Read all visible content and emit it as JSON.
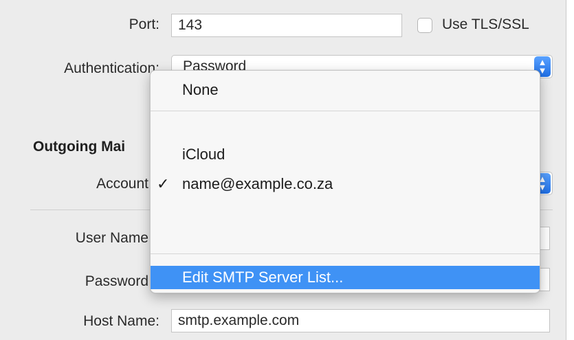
{
  "incoming": {
    "port_label": "Port:",
    "port_value": "143",
    "tls_label": "Use TLS/SSL",
    "auth_label": "Authentication:",
    "auth_value": "Password"
  },
  "outgoing": {
    "section_title": "Outgoing Mai",
    "account_label": "Account",
    "user_name_label": "User Name",
    "password_label": "Password",
    "host_name_label": "Host Name:",
    "host_name_value": "smtp.example.com"
  },
  "menu": {
    "items": [
      {
        "label": "None",
        "checked": false
      },
      {
        "label": "iCloud",
        "checked": false
      },
      {
        "label": "name@example.co.za",
        "checked": true
      },
      {
        "label": "Edit SMTP Server List...",
        "checked": false,
        "highlighted": true
      }
    ],
    "check_glyph": "✓",
    "highlight_color": "#3f92f5"
  },
  "icons": {
    "stepper": "updown-chevron-icon",
    "checkmark": "checkmark-icon"
  }
}
